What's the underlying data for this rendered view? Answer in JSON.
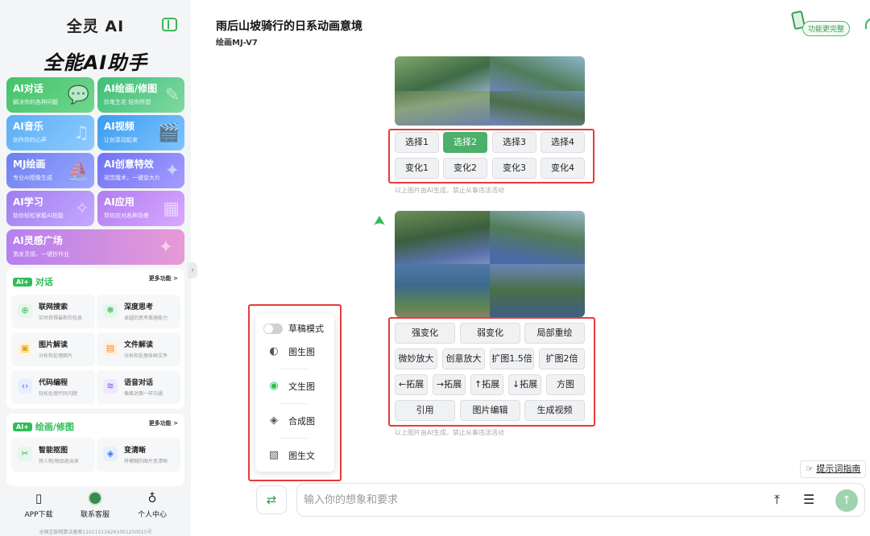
{
  "sidebar": {
    "brand": "全灵 AI",
    "hero_title": "全能AI助手",
    "cards": [
      {
        "title": "AI对话",
        "subtitle": "解决你的各种问题"
      },
      {
        "title": "AI绘画/修图",
        "subtitle": "妙笔生花 轻你所想"
      },
      {
        "title": "AI音乐",
        "subtitle": "创作你的心声"
      },
      {
        "title": "AI视频",
        "subtitle": "让创意动起来"
      },
      {
        "title": "MJ绘画",
        "subtitle": "专业AI图像生成"
      },
      {
        "title": "AI创意特效",
        "subtitle": "视觉魔术，一键变大片"
      },
      {
        "title": "AI学习",
        "subtitle": "助你轻松掌握AI技能"
      },
      {
        "title": "AI应用",
        "subtitle": "帮你应对各种场景"
      },
      {
        "title": "AI灵感广场",
        "subtitle": "激发灵感，一键抄作业"
      }
    ],
    "sections": [
      {
        "tag": "AI+",
        "title": "对话",
        "more": "更多功能 >",
        "items": [
          {
            "title": "联网搜索",
            "subtitle": "实时获得最新的信息"
          },
          {
            "title": "深度思考",
            "subtitle": "卓越的思考推理能力"
          },
          {
            "title": "图片解读",
            "subtitle": "分析和处理图片"
          },
          {
            "title": "文件解读",
            "subtitle": "分析和处理各种文件"
          },
          {
            "title": "代码编程",
            "subtitle": "轻松处理代码问题"
          },
          {
            "title": "语音对话",
            "subtitle": "像面对面一样沟通"
          }
        ]
      },
      {
        "tag": "AI+",
        "title": "绘画/修图",
        "more": "更多功能 >",
        "items": [
          {
            "title": "智能抠图",
            "subtitle": "将人物/物品抠出来"
          },
          {
            "title": "变清晰",
            "subtitle": "将模糊的图片变清晰"
          }
        ]
      }
    ],
    "bottom_nav": [
      {
        "label": "APP下载"
      },
      {
        "label": "联系客服"
      },
      {
        "label": "个人中心"
      }
    ],
    "icp": "全国互联网算法备案110115116261001250015号"
  },
  "chat": {
    "title": "雨后山坡骑行的日系动画意境",
    "subtitle": "绘画MJ-V7",
    "badge": "功能更完整"
  },
  "result1": {
    "buttons": [
      "选择1",
      "选择2",
      "选择3",
      "选择4",
      "变化1",
      "变化2",
      "变化3",
      "变化4"
    ],
    "active_index": 1,
    "disclaimer": "以上图片由AI生成，禁止从事违法活动"
  },
  "result2": {
    "buttons": [
      "强变化",
      "弱变化",
      "局部重绘",
      "微妙放大",
      "创意放大",
      "扩图1.5倍",
      "扩图2倍",
      "←拓展",
      "→拓展",
      "↑拓展",
      "↓拓展",
      "方图",
      "引用",
      "图片编辑",
      "生成视频"
    ],
    "disclaimer": "以上图片由AI生成，禁止从事违法活动"
  },
  "mode_popup": {
    "draft_label": "草稿模式",
    "draft_on": false,
    "items": [
      "图生图",
      "文生图",
      "合成图",
      "图生文"
    ]
  },
  "prompt_guide": "提示词指南",
  "input": {
    "placeholder": "输入你的想象和要求"
  },
  "colors": {
    "accent": "#4ab06a",
    "highlight_border": "#e63b3b"
  }
}
